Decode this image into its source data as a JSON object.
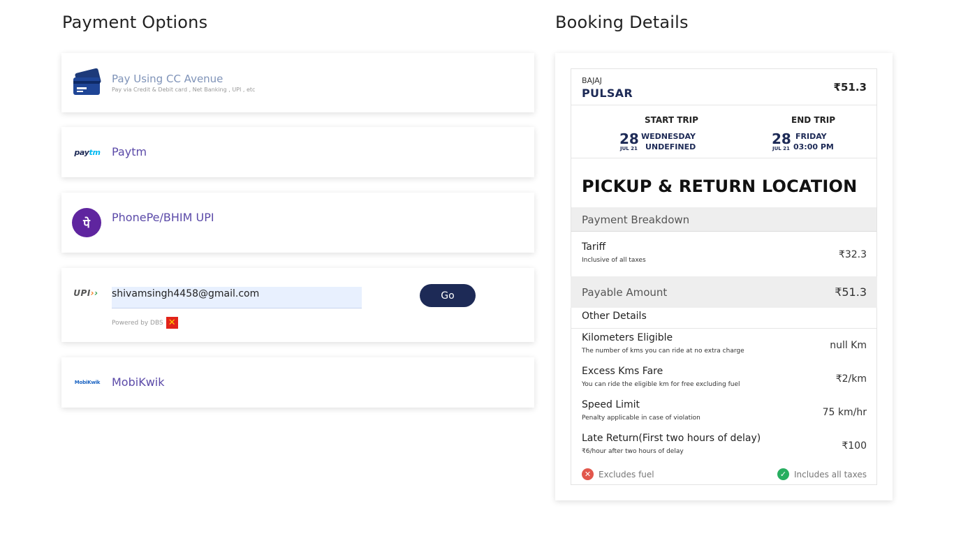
{
  "payment": {
    "title": "Payment Options",
    "cc_avenue": {
      "label": "Pay Using CC Avenue",
      "sub": "Pay via Credit & Debit card , Net Banking , UPI , etc",
      "icon": "credit-card-icon"
    },
    "paytm": {
      "label": "Paytm",
      "logo": "Paytm"
    },
    "phonepe": {
      "label": "PhonePe/BHIM UPI",
      "logo_glyph": "पे"
    },
    "upi": {
      "logo": "UPI",
      "input_value": "shivamsingh4458@gmail.com",
      "go_label": "Go",
      "powered_by": "Powered by DBS"
    },
    "mobikwik": {
      "label": "MobiKwik",
      "logo": "MobiKwik"
    }
  },
  "booking": {
    "title": "Booking Details",
    "brand": "BAJAJ",
    "model": "PULSAR",
    "price": "₹51.3",
    "start_trip": {
      "heading": "START TRIP",
      "day": "28",
      "month": "JUL 21",
      "weekday": "WEDNESDAY",
      "time": "UNDEFINED"
    },
    "end_trip": {
      "heading": "END TRIP",
      "day": "28",
      "month": "JUL 21",
      "weekday": "FRIDAY",
      "time": "03:00 PM"
    },
    "pickup_heading": "PICKUP & RETURN LOCATION",
    "breakdown_heading": "Payment Breakdown",
    "tariff": {
      "title": "Tariff",
      "sub": "Inclusive of all taxes",
      "value": "₹32.3"
    },
    "payable": {
      "title": "Payable Amount",
      "value": "₹51.3"
    },
    "other_heading": "Other Details",
    "details": [
      {
        "title": "Kilometers Eligible",
        "sub": "The number of kms you can ride at no extra charge",
        "value": "null Km"
      },
      {
        "title": "Excess Kms Fare",
        "sub": "You can ride the eligible km for free excluding fuel",
        "value": "₹2/km"
      },
      {
        "title": "Speed Limit",
        "sub": "Penalty applicable in case of violation",
        "value": "75 km/hr"
      },
      {
        "title": "Late Return(First two hours of delay)",
        "sub": "₹6/hour after two hours of delay",
        "value": "₹100"
      }
    ],
    "excludes": "Excludes fuel",
    "includes": "Includes all taxes"
  },
  "colors": {
    "navy": "#1d2a56",
    "purple": "#5b4aa8",
    "phonepe": "#5f259f",
    "red": "#e2574c",
    "green": "#27ae60"
  }
}
